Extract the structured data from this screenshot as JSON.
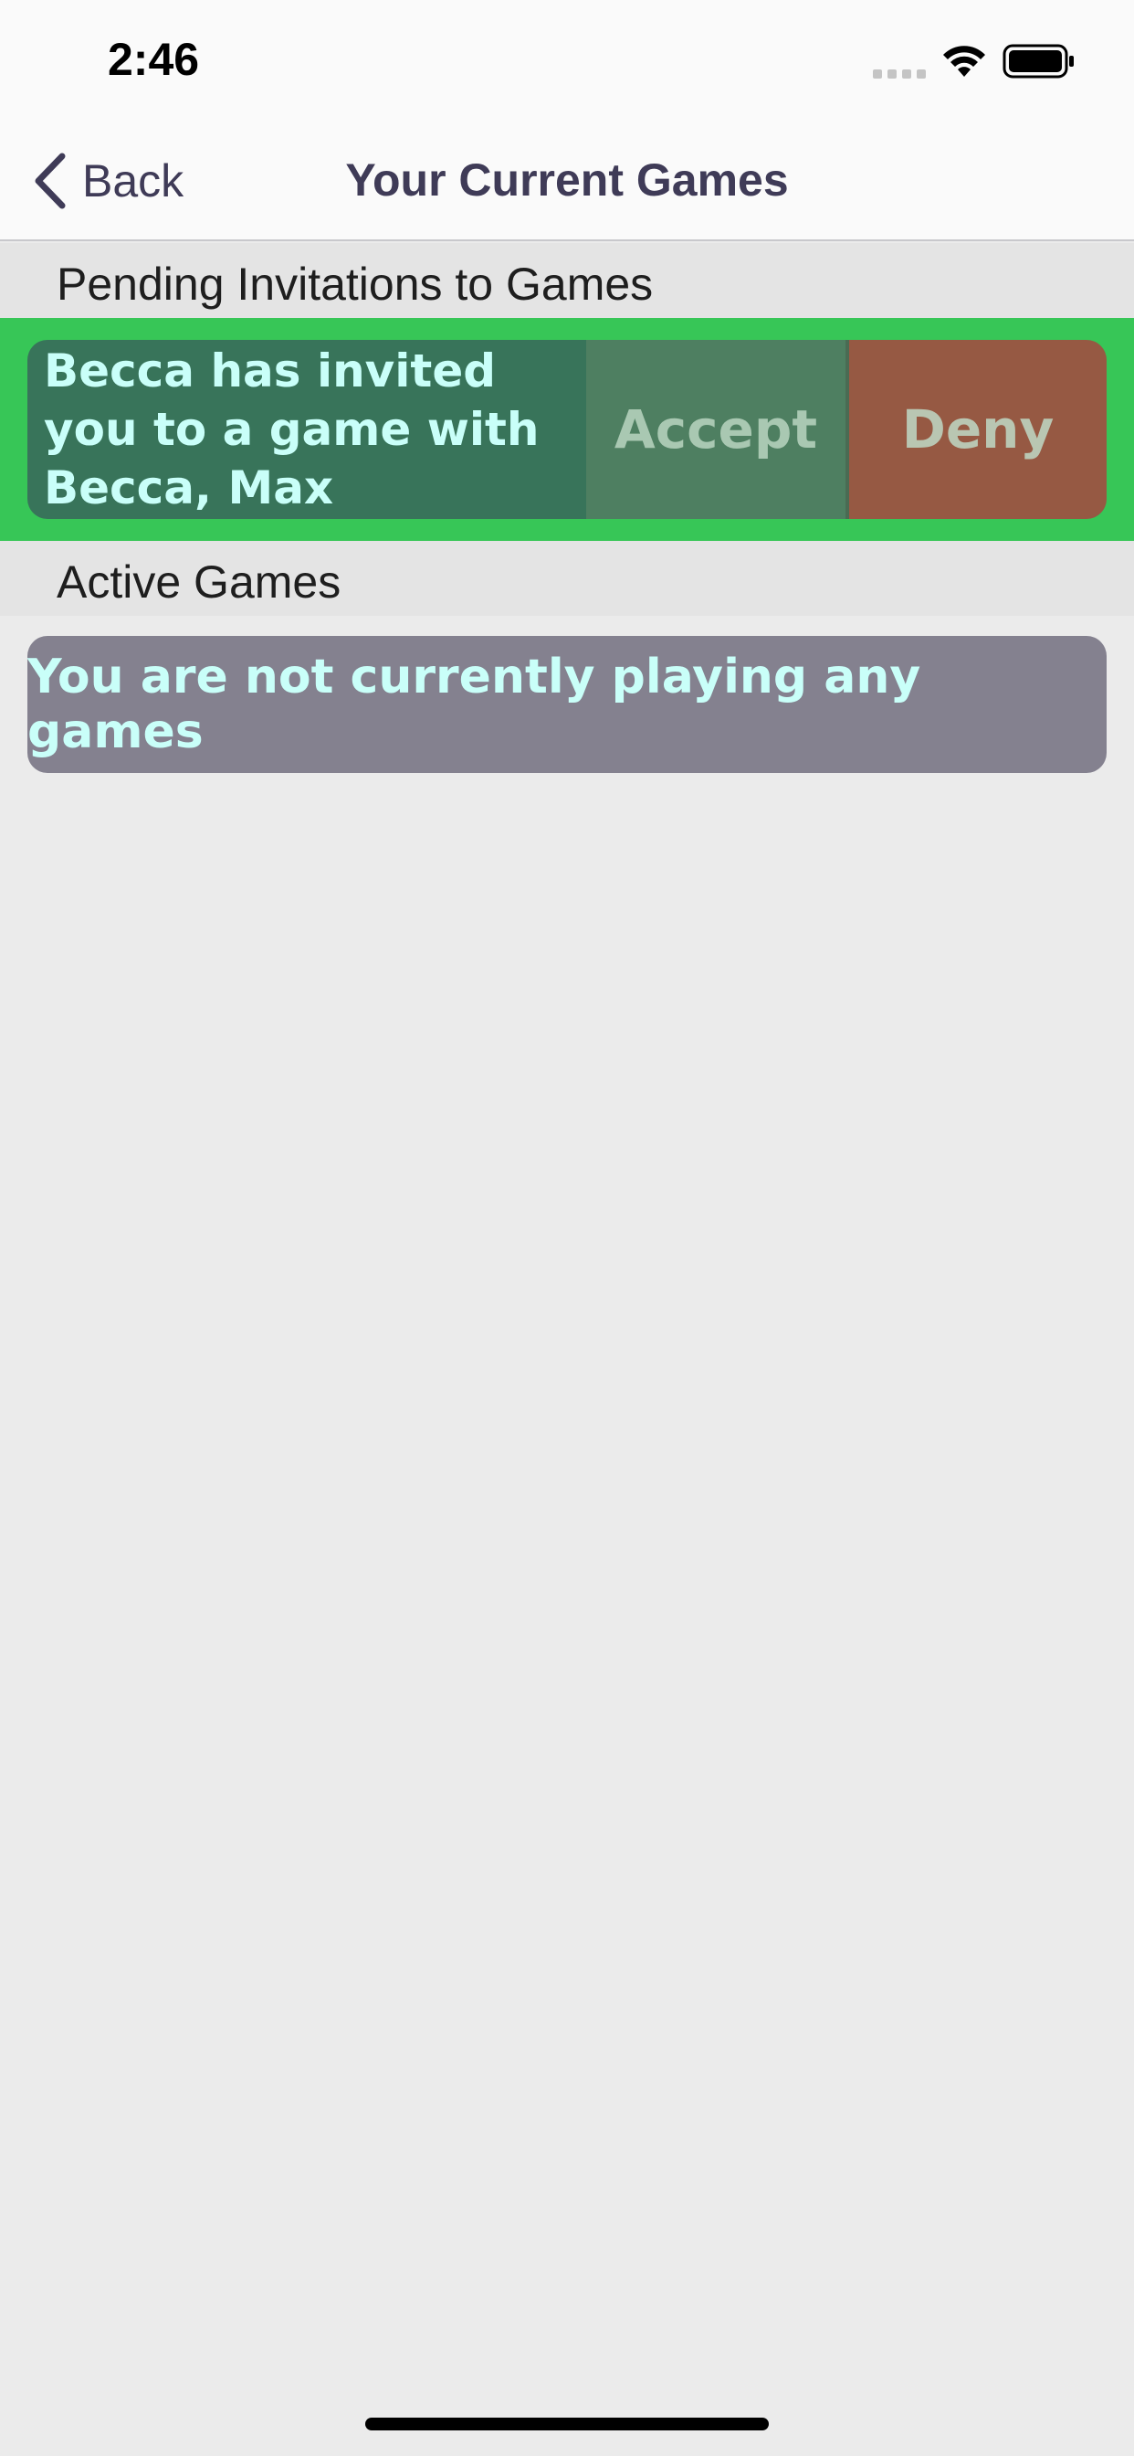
{
  "status_bar": {
    "time": "2:46",
    "icons": [
      "signal-icon",
      "wifi-icon",
      "battery-icon"
    ]
  },
  "nav": {
    "back_label": "Back",
    "back_icon": "chevron-left-icon",
    "title": "Your Current Games"
  },
  "sections": {
    "pending_title": "Pending Invitations to Games",
    "active_title": "Active Games"
  },
  "invitation": {
    "message": "Becca has invited you to a game with Becca, Max",
    "accept_label": "Accept",
    "deny_label": "Deny"
  },
  "active_games": {
    "empty_message": "You are not currently playing any games"
  },
  "colors": {
    "accent_text": "#3f3b57",
    "invite_row_bg": "#37c657",
    "invite_message_bg": "#38745a",
    "accept_bg": "#4e7f61",
    "deny_bg": "#965943",
    "empty_card_bg": "#84818f",
    "card_text": "#c9fff9"
  }
}
